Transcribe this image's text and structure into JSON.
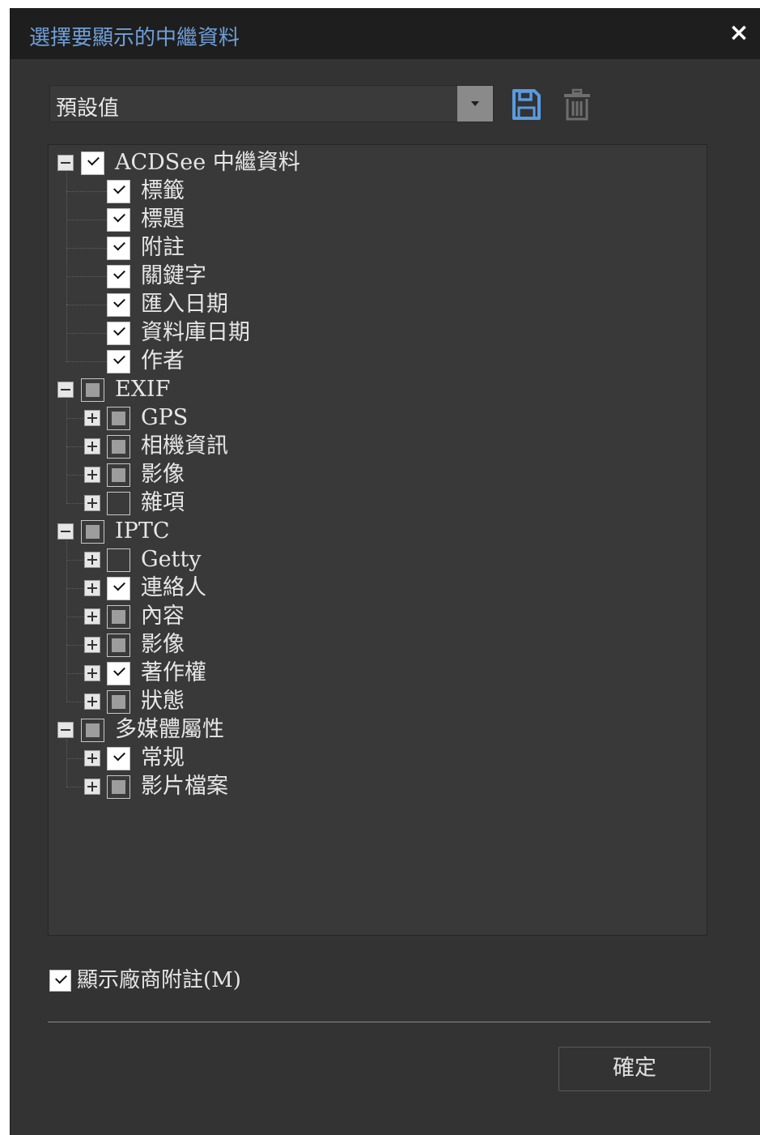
{
  "window": {
    "title": "選擇要顯示的中繼資料",
    "close_label": "×"
  },
  "preset": {
    "selected": "預設值",
    "save_icon": "save-icon",
    "delete_icon": "trash-icon",
    "accent_color": "#5a9be0"
  },
  "tree": {
    "nodes": [
      {
        "label": "ACDSee 中繼資料",
        "level": 0,
        "expander": "minus",
        "state": "checked"
      },
      {
        "label": "標籤",
        "level": 1,
        "expander": "none",
        "state": "checked"
      },
      {
        "label": "標題",
        "level": 1,
        "expander": "none",
        "state": "checked"
      },
      {
        "label": "附註",
        "level": 1,
        "expander": "none",
        "state": "checked"
      },
      {
        "label": "關鍵字",
        "level": 1,
        "expander": "none",
        "state": "checked"
      },
      {
        "label": "匯入日期",
        "level": 1,
        "expander": "none",
        "state": "checked"
      },
      {
        "label": "資料庫日期",
        "level": 1,
        "expander": "none",
        "state": "checked"
      },
      {
        "label": "作者",
        "level": 1,
        "expander": "none",
        "state": "checked"
      },
      {
        "label": "EXIF",
        "level": 0,
        "expander": "minus",
        "state": "partial"
      },
      {
        "label": "GPS",
        "level": 1,
        "expander": "plus",
        "state": "partial"
      },
      {
        "label": "相機資訊",
        "level": 1,
        "expander": "plus",
        "state": "partial"
      },
      {
        "label": "影像",
        "level": 1,
        "expander": "plus",
        "state": "partial"
      },
      {
        "label": "雜項",
        "level": 1,
        "expander": "plus",
        "state": "unchecked"
      },
      {
        "label": "IPTC",
        "level": 0,
        "expander": "minus",
        "state": "partial"
      },
      {
        "label": "Getty",
        "level": 1,
        "expander": "plus",
        "state": "unchecked"
      },
      {
        "label": "連絡人",
        "level": 1,
        "expander": "plus",
        "state": "checked"
      },
      {
        "label": "內容",
        "level": 1,
        "expander": "plus",
        "state": "partial"
      },
      {
        "label": "影像",
        "level": 1,
        "expander": "plus",
        "state": "partial"
      },
      {
        "label": "著作權",
        "level": 1,
        "expander": "plus",
        "state": "checked"
      },
      {
        "label": "狀態",
        "level": 1,
        "expander": "plus",
        "state": "partial"
      },
      {
        "label": "多媒體屬性",
        "level": 0,
        "expander": "minus",
        "state": "partial"
      },
      {
        "label": "常规",
        "level": 1,
        "expander": "plus",
        "state": "checked"
      },
      {
        "label": "影片檔案",
        "level": 1,
        "expander": "plus",
        "state": "partial"
      }
    ]
  },
  "options": {
    "vendor_notes_label": "顯示廠商附註(M)",
    "vendor_notes_checked": true
  },
  "buttons": {
    "ok_label": "確定"
  }
}
